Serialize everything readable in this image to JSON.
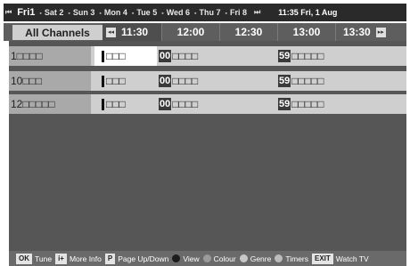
{
  "date_bar": {
    "rewind_glyph": "⏮",
    "forward_glyph": "⏭",
    "current_day": "Fri1",
    "days": [
      "Sat 2",
      "Sun 3",
      "Mon 4",
      "Tue 5",
      "Wed 6",
      "Thu 7",
      "Fri 8"
    ],
    "clock": "11:35 Fri, 1 Aug"
  },
  "time_bar": {
    "channel_filter": "All Channels",
    "back_glyph": "◂◂",
    "next_glyph": "▸▸",
    "slots": [
      "11:30",
      "12:00",
      "12:30",
      "13:00",
      "13:30"
    ]
  },
  "rows": [
    {
      "channel": "1□□□□",
      "programs": [
        {
          "time": "",
          "title": "□□□",
          "selected": true
        },
        {
          "time": "00",
          "title": "□□□□"
        },
        {
          "time": "59",
          "title": "□□□□□"
        }
      ]
    },
    {
      "channel": "10□□□",
      "programs": [
        {
          "time": "",
          "title": "□□□",
          "selected": false
        },
        {
          "time": "00",
          "title": "□□□□"
        },
        {
          "time": "59",
          "title": "□□□□□"
        }
      ]
    },
    {
      "channel": "12□□□□□",
      "programs": [
        {
          "time": "",
          "title": "□□□",
          "selected": false
        },
        {
          "time": "00",
          "title": "□□□□"
        },
        {
          "time": "59",
          "title": "□□□□□"
        }
      ]
    }
  ],
  "help_bar": {
    "ok_key": "OK",
    "ok_label": "Tune",
    "info_key": "i+",
    "info_label": "More Info",
    "page_key": "P",
    "page_label": "Page Up/Down",
    "view_label": "View",
    "colour_label": "Colour",
    "genre_label": "Genre",
    "timers_label": "Timers",
    "exit_key": "EXIT",
    "exit_label": "Watch TV"
  },
  "colors": {
    "dot_view": "#1c1c1c",
    "dot_colour": "#9a9a9a",
    "dot_genre": "#c8c8c8",
    "dot_timers": "#bdbdbd"
  }
}
